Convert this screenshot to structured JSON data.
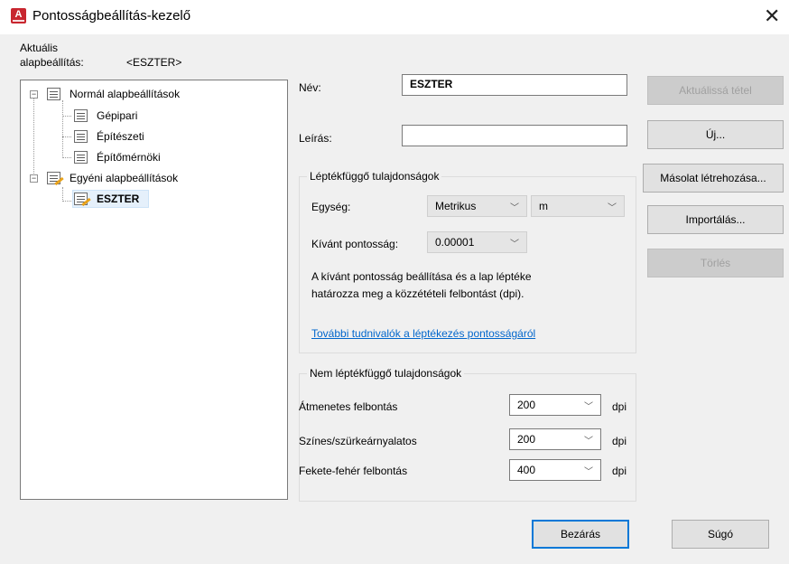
{
  "window": {
    "title": "Pontosságbeállítás-kezelő",
    "app_icon_letter": "A",
    "close_glyph": "✕"
  },
  "current": {
    "label_line1": "Aktuális",
    "label_line2": "alapbeállítás:",
    "value": "<ESZTER>"
  },
  "tree": {
    "items": [
      {
        "label": "Normál alapbeállítások",
        "level": 0,
        "expander": "−"
      },
      {
        "label": "Gépipari",
        "level": 1
      },
      {
        "label": "Építészeti",
        "level": 1
      },
      {
        "label": "Építőmérnöki",
        "level": 1
      },
      {
        "label": "Egyéni alapbeállítások",
        "level": 0,
        "expander": "−"
      },
      {
        "label": "ESZTER",
        "level": 1,
        "selected": true
      }
    ]
  },
  "form": {
    "name_label": "Név:",
    "name_value": "ESZTER",
    "desc_label": "Leírás:",
    "desc_value": ""
  },
  "scale_dependent": {
    "title": "Léptékfüggő tulajdonságok",
    "unit_label": "Egység:",
    "unit_value": "Metrikus",
    "unit2_value": "m",
    "precision_label": "Kívánt pontosság:",
    "precision_value": "0.00001",
    "description_line1": "A kívánt pontosság beállítása és a lap léptéke",
    "description_line2": "határozza meg a közzétételi felbontást (dpi).",
    "link": "További tudnivalók a léptékezés pontosságáról"
  },
  "scale_independent": {
    "title": "Nem léptékfüggő tulajdonságok",
    "rows": [
      {
        "label": "Átmenetes felbontás",
        "value": "200",
        "unit": "dpi"
      },
      {
        "label": "Színes/szürkeárnyalatos",
        "value": "200",
        "unit": "dpi"
      },
      {
        "label": "Fekete-fehér felbontás",
        "value": "400",
        "unit": "dpi"
      }
    ]
  },
  "buttons": {
    "set_current": "Aktuálissá tétel",
    "new": "Új...",
    "copy": "Másolat létrehozása...",
    "import": "Importálás...",
    "delete": "Törlés",
    "close": "Bezárás",
    "help": "Súgó"
  },
  "colors": {
    "link": "#0066cc",
    "default_button_border": "#0078d7",
    "app_icon": "#c8262f"
  }
}
